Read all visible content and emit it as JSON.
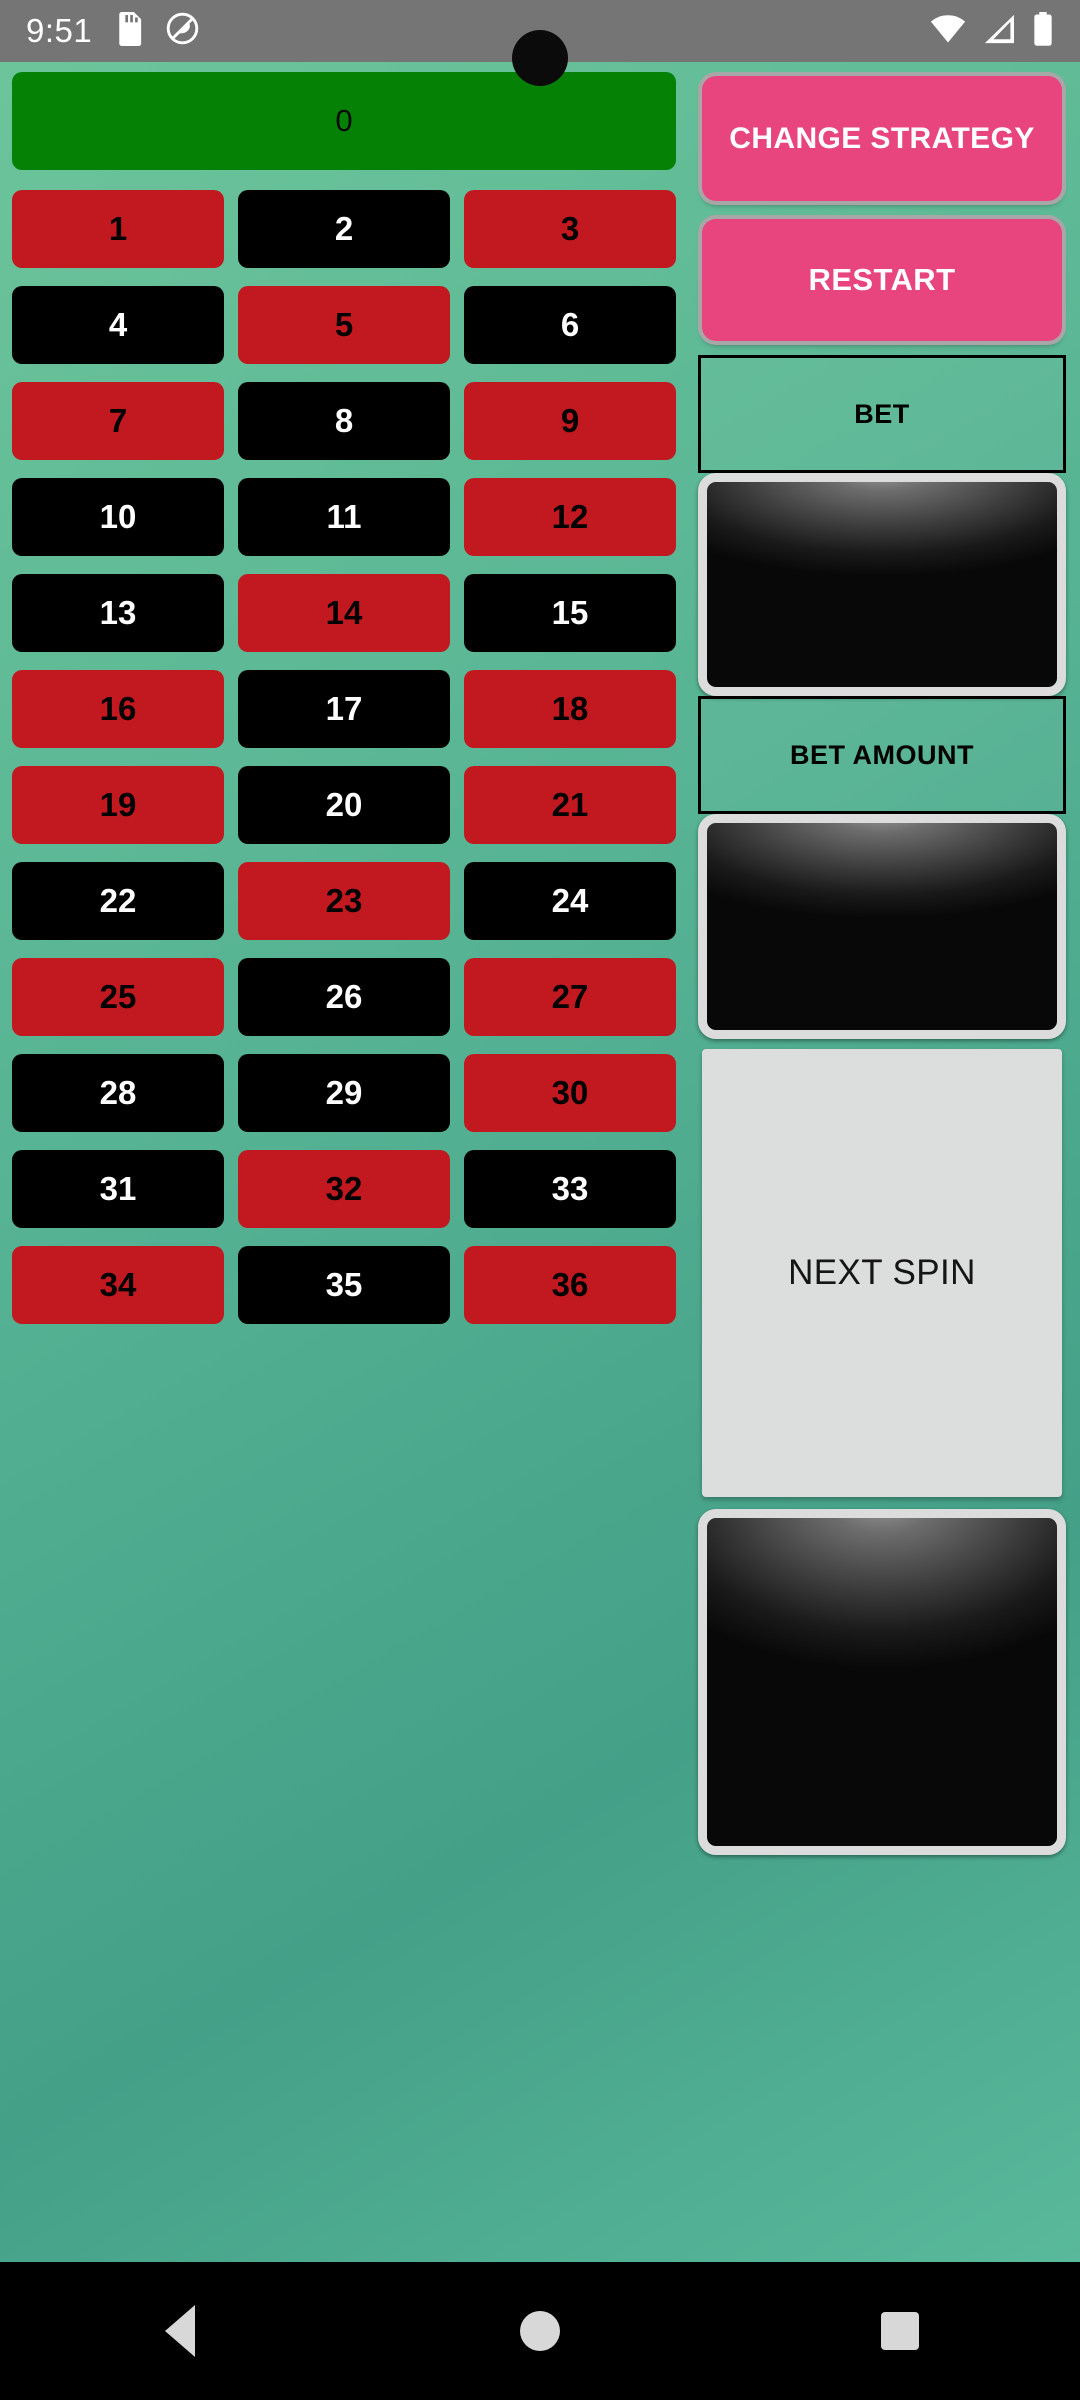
{
  "status_bar": {
    "time": "9:51",
    "icons": [
      "sd-card-icon",
      "do-not-disturb-icon",
      "wifi-icon",
      "cellular-signal-icon",
      "battery-icon"
    ]
  },
  "board": {
    "zero": {
      "label": "0",
      "color": "green"
    },
    "colors": {
      "green": "#058205",
      "red": "#c1191f",
      "black": "#000000",
      "background": "#4fae91"
    },
    "numbers": [
      {
        "label": "1",
        "color": "red"
      },
      {
        "label": "2",
        "color": "black"
      },
      {
        "label": "3",
        "color": "red"
      },
      {
        "label": "4",
        "color": "black"
      },
      {
        "label": "5",
        "color": "red"
      },
      {
        "label": "6",
        "color": "black"
      },
      {
        "label": "7",
        "color": "red"
      },
      {
        "label": "8",
        "color": "black"
      },
      {
        "label": "9",
        "color": "red"
      },
      {
        "label": "10",
        "color": "black"
      },
      {
        "label": "11",
        "color": "black"
      },
      {
        "label": "12",
        "color": "red"
      },
      {
        "label": "13",
        "color": "black"
      },
      {
        "label": "14",
        "color": "red"
      },
      {
        "label": "15",
        "color": "black"
      },
      {
        "label": "16",
        "color": "red"
      },
      {
        "label": "17",
        "color": "black"
      },
      {
        "label": "18",
        "color": "red"
      },
      {
        "label": "19",
        "color": "red"
      },
      {
        "label": "20",
        "color": "black"
      },
      {
        "label": "21",
        "color": "red"
      },
      {
        "label": "22",
        "color": "black"
      },
      {
        "label": "23",
        "color": "red"
      },
      {
        "label": "24",
        "color": "black"
      },
      {
        "label": "25",
        "color": "red"
      },
      {
        "label": "26",
        "color": "black"
      },
      {
        "label": "27",
        "color": "red"
      },
      {
        "label": "28",
        "color": "black"
      },
      {
        "label": "29",
        "color": "black"
      },
      {
        "label": "30",
        "color": "red"
      },
      {
        "label": "31",
        "color": "black"
      },
      {
        "label": "32",
        "color": "red"
      },
      {
        "label": "33",
        "color": "black"
      },
      {
        "label": "34",
        "color": "red"
      },
      {
        "label": "35",
        "color": "black"
      },
      {
        "label": "36",
        "color": "red"
      }
    ]
  },
  "panel": {
    "change_strategy_label": "CHANGE STRATEGY",
    "restart_label": "RESTART",
    "bet_label": "BET",
    "bet_value": "",
    "bet_amount_label": "BET AMOUNT",
    "bet_amount_value": "",
    "next_spin_label": "NEXT SPIN",
    "spin_result_value": "",
    "accent_pink": "#e8457e",
    "next_spin_bg": "#dcdedd"
  },
  "nav_bar": {
    "back_label": "Back",
    "home_label": "Home",
    "recents_label": "Recents"
  }
}
